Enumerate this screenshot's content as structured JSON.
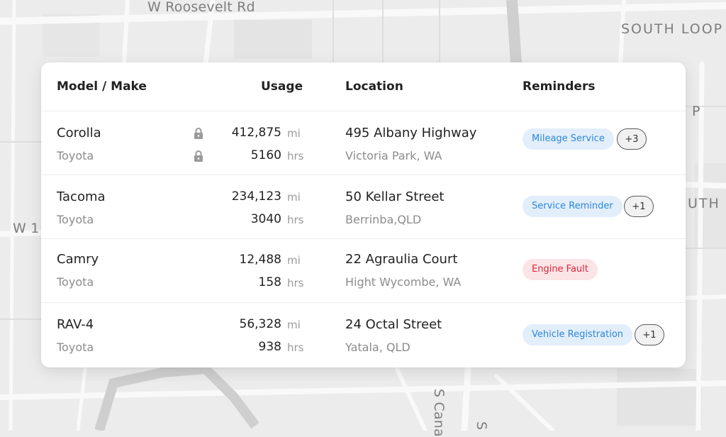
{
  "map": {
    "labels": [
      "W Roosevelt Rd",
      "SOUTH LOOP",
      "W 1",
      "P",
      "UTH",
      "S Cana",
      "S"
    ]
  },
  "table": {
    "headers": {
      "model": "Model / Make",
      "usage": "Usage",
      "location": "Location",
      "reminders": "Reminders"
    },
    "rows": [
      {
        "model": "Corolla",
        "make": "Toyota",
        "mileage": "412,875",
        "mileage_unit": "mi",
        "hours": "5160",
        "hours_unit": "hrs",
        "locked": true,
        "address": "495 Albany Highway",
        "suburb": "Victoria Park, WA",
        "reminder": "Mileage Service",
        "reminder_status": "info",
        "more": "+3"
      },
      {
        "model": "Tacoma",
        "make": "Toyota",
        "mileage": "234,123",
        "mileage_unit": "mi",
        "hours": "3040",
        "hours_unit": "hrs",
        "locked": false,
        "address": "50 Kellar Street",
        "suburb": "Berrinba,QLD",
        "reminder": "Service Reminder",
        "reminder_status": "info",
        "more": "+1"
      },
      {
        "model": "Camry",
        "make": "Toyota",
        "mileage": "12,488",
        "mileage_unit": "mi",
        "hours": "158",
        "hours_unit": "hrs",
        "locked": false,
        "address": "22 Agraulia Court",
        "suburb": "Hight Wycombe, WA",
        "reminder": "Engine Fault",
        "reminder_status": "error",
        "more": ""
      },
      {
        "model": "RAV-4",
        "make": "Toyota",
        "mileage": "56,328",
        "mileage_unit": "mi",
        "hours": "938",
        "hours_unit": "hrs",
        "locked": false,
        "address": "24 Octal Street",
        "suburb": "Yatala, QLD",
        "reminder": "Vehicle Registration",
        "reminder_status": "info",
        "more": "+1"
      }
    ]
  },
  "colors": {
    "info_bg": "#e3eefb",
    "info_text": "#2a88d8",
    "error_bg": "#fbe4e6",
    "error_text": "#d9283a",
    "map_bg": "#ececec"
  },
  "icons": {
    "lock": "lock-icon"
  }
}
